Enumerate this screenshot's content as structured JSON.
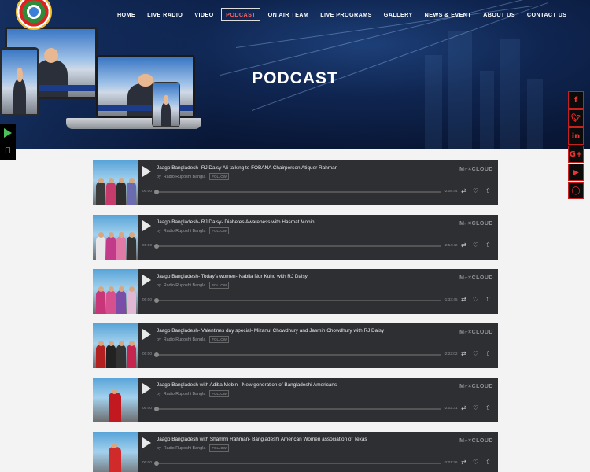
{
  "brand": {
    "logo_text": "RADIO RUPOSHI BANGLA"
  },
  "nav": [
    "HOME",
    "LIVE RADIO",
    "VIDEO",
    "PODCAST",
    "ON AIR TEAM",
    "LIVE PROGRAMS",
    "GALLERY",
    "NEWS & EVENT",
    "ABOUT US",
    "CONTACT US"
  ],
  "nav_active": "PODCAST",
  "hero": {
    "title": "PODCAST"
  },
  "social": [
    "f",
    "t",
    "in",
    "G+",
    "yt",
    "ig"
  ],
  "podcasts": [
    {
      "title": "Jaago Bangladesh- RJ Daisy Ali talking to FOBANA Chairperson Atiquer Rahman",
      "by": "by",
      "author": "Radio Ruposhi Bangla",
      "follow": "FOLLOW",
      "start": "00:00",
      "end": "-2:08:44",
      "brand": "M⌐×CLOUD"
    },
    {
      "title": "Jaago Bangladesh- RJ Daisy- Diabetes Awareness with Hasmat Mobin",
      "by": "by",
      "author": "Radio Ruposhi Bangla",
      "follow": "FOLLOW",
      "start": "00:00",
      "end": "-2:54:42",
      "brand": "M⌐×CLOUD"
    },
    {
      "title": "Jaago Bangladesh- Today's women- Nabila Nur Kuhu with RJ Daisy",
      "by": "by",
      "author": "Radio Ruposhi Bangla",
      "follow": "FOLLOW",
      "start": "00:00",
      "end": "-1:33:45",
      "brand": "M⌐×CLOUD"
    },
    {
      "title": "Jaago Bangladesh- Valentines day special- Mizanul Chowdhury and Jasmin Chowdhury with RJ Daisy",
      "by": "by",
      "author": "Radio Ruposhi Bangla",
      "follow": "FOLLOW",
      "start": "00:00",
      "end": "-2:22:02",
      "brand": "M⌐×CLOUD"
    },
    {
      "title": "Jaago Bangladesh with Adiba Mobin - New generation of Bangladeshi Americans",
      "by": "by",
      "author": "Radio Ruposhi Bangla",
      "follow": "FOLLOW",
      "start": "00:00",
      "end": "-2:02:31",
      "brand": "M⌐×CLOUD"
    },
    {
      "title": "Jaago Bangladesh with Shammi Rahman- Bangladeshi American Women association of Texas",
      "by": "by",
      "author": "Radio Ruposhi Bangla",
      "follow": "FOLLOW",
      "start": "00:00",
      "end": "-2:01:36",
      "brand": "M⌐×CLOUD"
    }
  ],
  "colors": {
    "accent": "#e53935",
    "card_bg": "#2d2f33",
    "page_bg": "#f3f3f3"
  }
}
